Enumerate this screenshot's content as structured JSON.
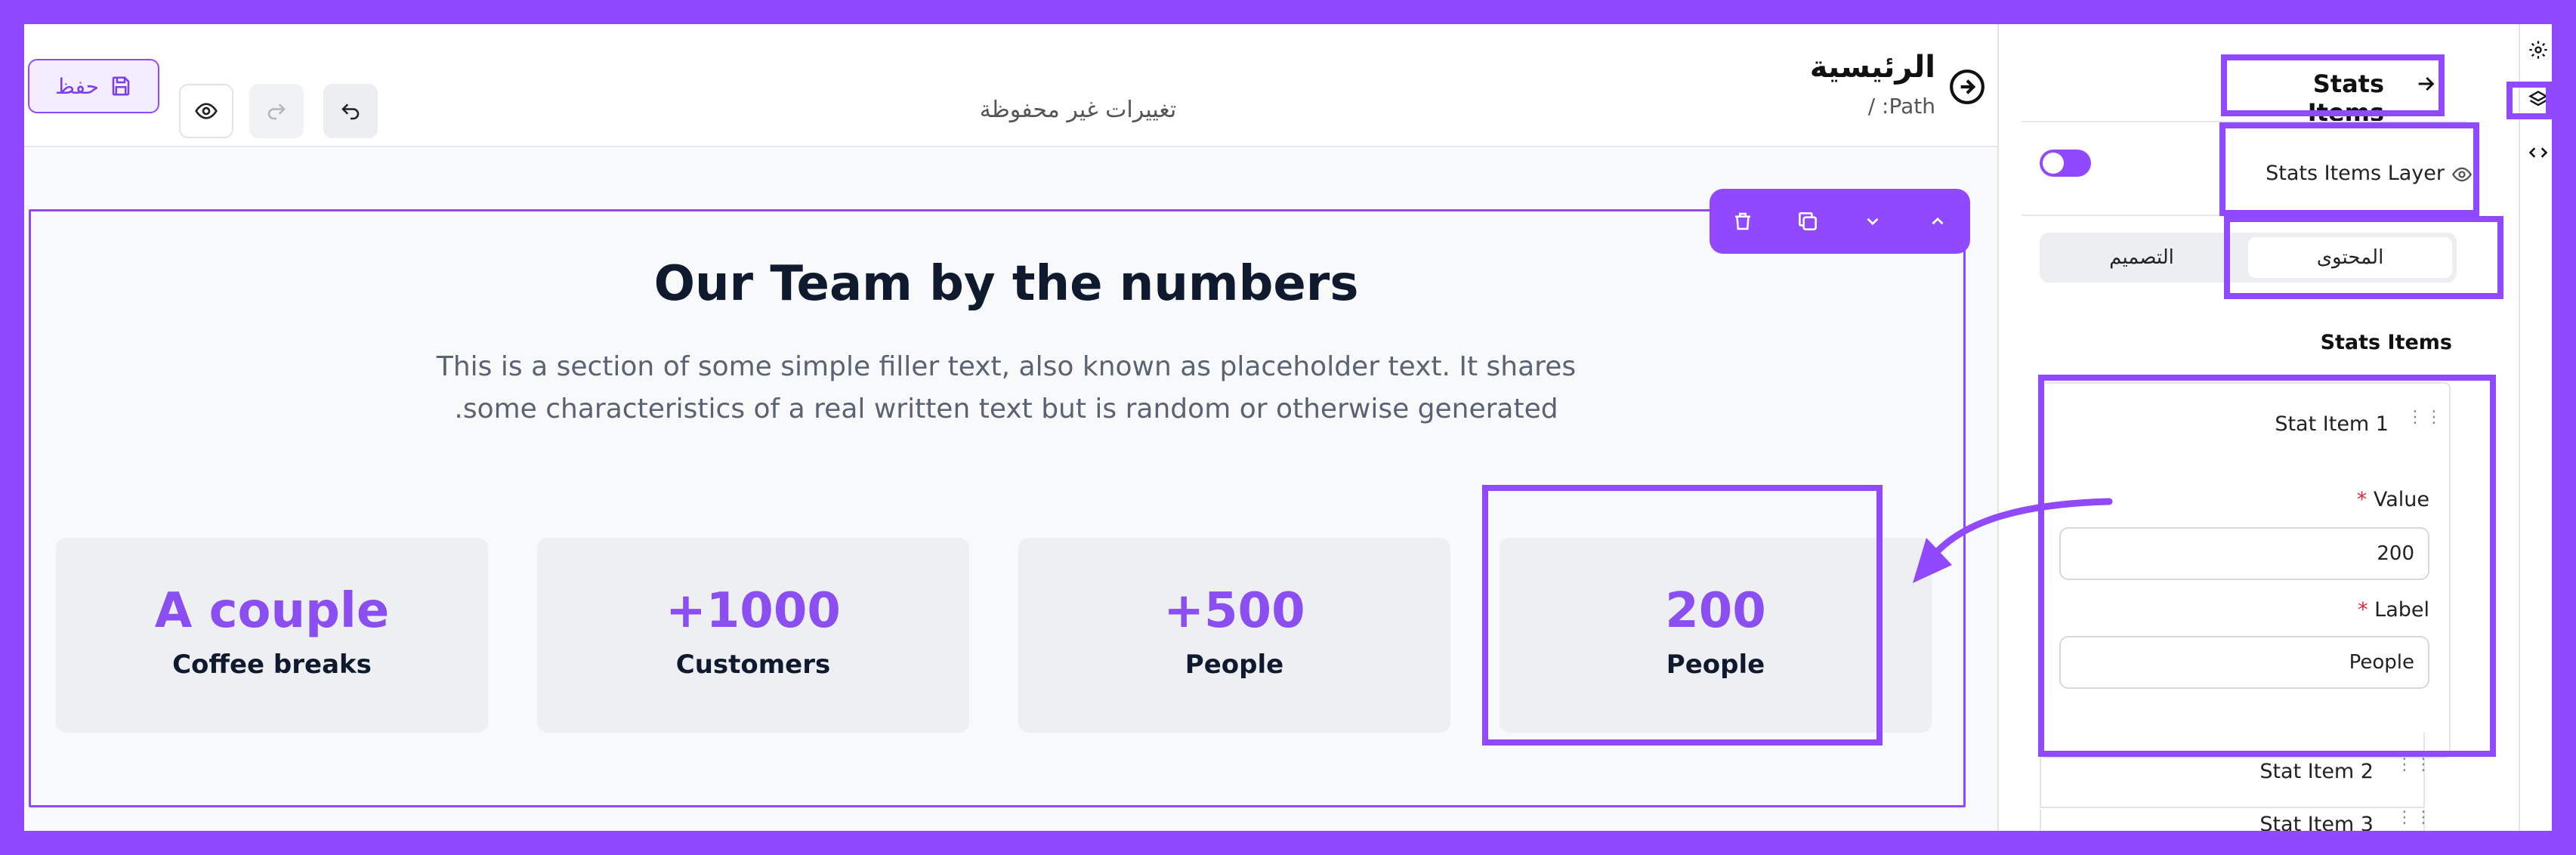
{
  "header": {
    "page_title": "الرئيسية",
    "path": "Path: /",
    "unsaved_status": "تغييرات غير محفوظة",
    "save_label": "حفظ"
  },
  "canvas": {
    "section_title": "Our Team by the numbers",
    "section_text_line1": "This is a section of some simple filler text, also known as placeholder text. It shares",
    "section_text_line2": ".some characteristics of a real written text but is random or otherwise generated",
    "stats": [
      {
        "value": "A couple",
        "label": "Coffee breaks"
      },
      {
        "value": "+1000",
        "label": "Customers"
      },
      {
        "value": "+500",
        "label": "People"
      },
      {
        "value": "200",
        "label": "People"
      }
    ]
  },
  "panel": {
    "title": "Stats Items",
    "layer_label": "Stats Items Layer",
    "layer_visible": true,
    "tabs": [
      {
        "label": "المحتوى",
        "active": true
      },
      {
        "label": "التصميم",
        "active": false
      }
    ],
    "list_heading": "Stats Items",
    "items": [
      {
        "title": "Stat Item 1",
        "expanded": true
      },
      {
        "title": "Stat Item 2",
        "expanded": false
      },
      {
        "title": "Stat Item 3",
        "expanded": false
      }
    ],
    "fields": {
      "value_label": "Value",
      "value": "200",
      "label_label": "Label",
      "label": "People",
      "required_mark": "*"
    }
  },
  "colors": {
    "accent": "#9149ff",
    "stat_value": "#8b4ef0",
    "heading": "#0f1a2e",
    "canvas_bg": "#f8f9fb",
    "card_bg": "#eeeff3"
  },
  "icons": {
    "back": "arrow-circle-right-icon",
    "settings": "gear-icon",
    "layers": "layers-icon",
    "code": "code-icon",
    "delete": "trash-icon",
    "duplicate": "copy-icon",
    "move_down": "chevron-down-icon",
    "move_up": "chevron-up-icon",
    "drag": "drag-handle-icon"
  }
}
